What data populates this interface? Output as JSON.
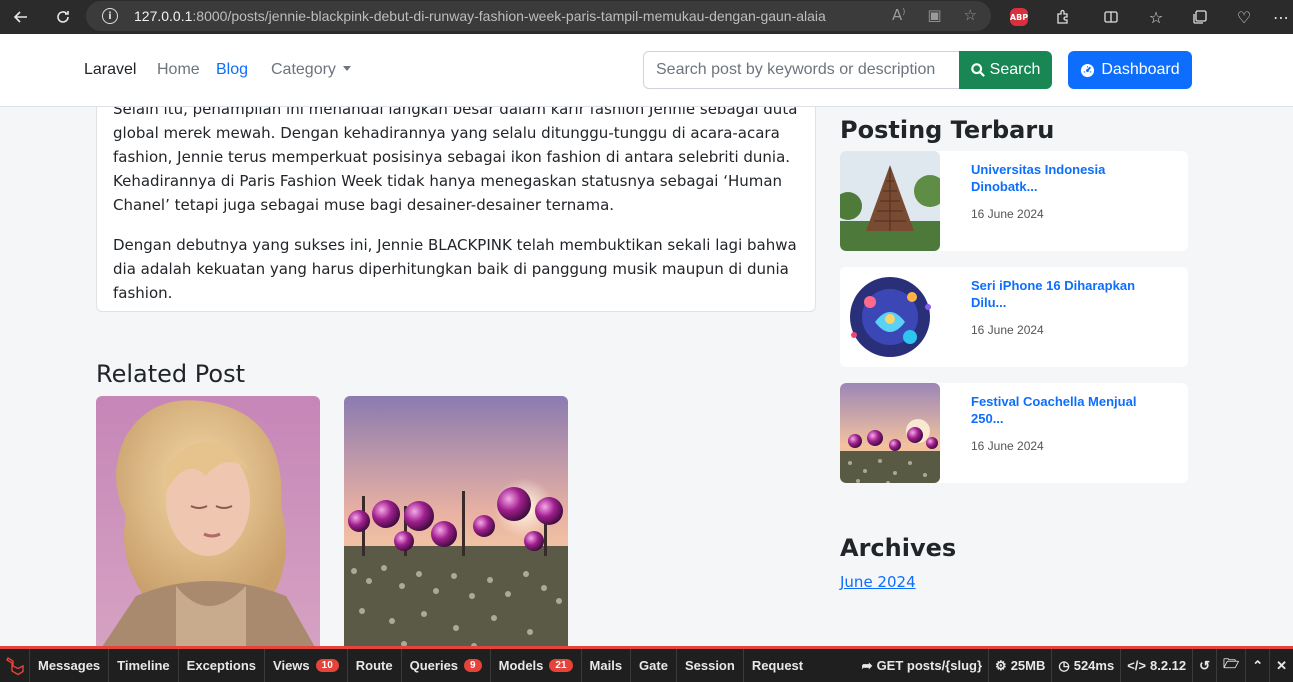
{
  "browser": {
    "url_host": "127.0.0.1",
    "url_rest": ":8000/posts/jennie-blackpink-debut-di-runway-fashion-week-paris-tampil-memukau-dengan-gaun-alaia",
    "abp_label": "ABP"
  },
  "navbar": {
    "brand": "Laravel",
    "links": [
      {
        "label": "Home",
        "active": false
      },
      {
        "label": "Blog",
        "active": true
      },
      {
        "label": "Category",
        "active": false
      }
    ],
    "search_placeholder": "Search post by keywords or description",
    "search_label": "Search",
    "dashboard_label": "Dashboard"
  },
  "article": {
    "paragraphs": [
      "Selain itu, penampilan ini menandai langkah besar dalam karir fashion Jennie sebagai duta global merek mewah. Dengan kehadirannya yang selalu ditunggu-tunggu di acara-acara fashion, Jennie terus memperkuat posisinya sebagai ikon fashion di antara selebriti dunia. Kehadirannya di Paris Fashion Week tidak hanya menegaskan statusnya sebagai ‘Human Chanel’ tetapi juga sebagai muse bagi desainer-desainer ternama.",
      "Dengan debutnya yang sukses ini, Jennie BLACKPINK telah membuktikan sekali lagi bahwa dia adalah kekuatan yang harus diperhitungkan baik di panggung musik maupun di dunia fashion."
    ]
  },
  "related": {
    "title": "Related Post"
  },
  "sidebar": {
    "latest_title": "Posting Terbaru",
    "latest": [
      {
        "title": "Universitas Indonesia Dinobatk...",
        "date": "16 June 2024"
      },
      {
        "title": "Seri iPhone 16 Diharapkan Dilu...",
        "date": "16 June 2024"
      },
      {
        "title": "Festival Coachella Menjual 250...",
        "date": "16 June 2024"
      }
    ],
    "archives_title": "Archives",
    "archives": [
      "June 2024"
    ]
  },
  "debugbar": {
    "tabs": [
      {
        "label": "Messages",
        "badge": ""
      },
      {
        "label": "Timeline",
        "badge": ""
      },
      {
        "label": "Exceptions",
        "badge": ""
      },
      {
        "label": "Views",
        "badge": "10"
      },
      {
        "label": "Route",
        "badge": ""
      },
      {
        "label": "Queries",
        "badge": "9"
      },
      {
        "label": "Models",
        "badge": "21"
      },
      {
        "label": "Mails",
        "badge": ""
      },
      {
        "label": "Gate",
        "badge": ""
      },
      {
        "label": "Session",
        "badge": ""
      },
      {
        "label": "Request",
        "badge": ""
      }
    ],
    "route": "GET posts/{slug}",
    "memory": "25MB",
    "time": "524ms",
    "php_version": "8.2.12"
  },
  "colors": {
    "primary": "#0d6efd",
    "success": "#198754",
    "debugbar_accent": "#e6433a"
  }
}
